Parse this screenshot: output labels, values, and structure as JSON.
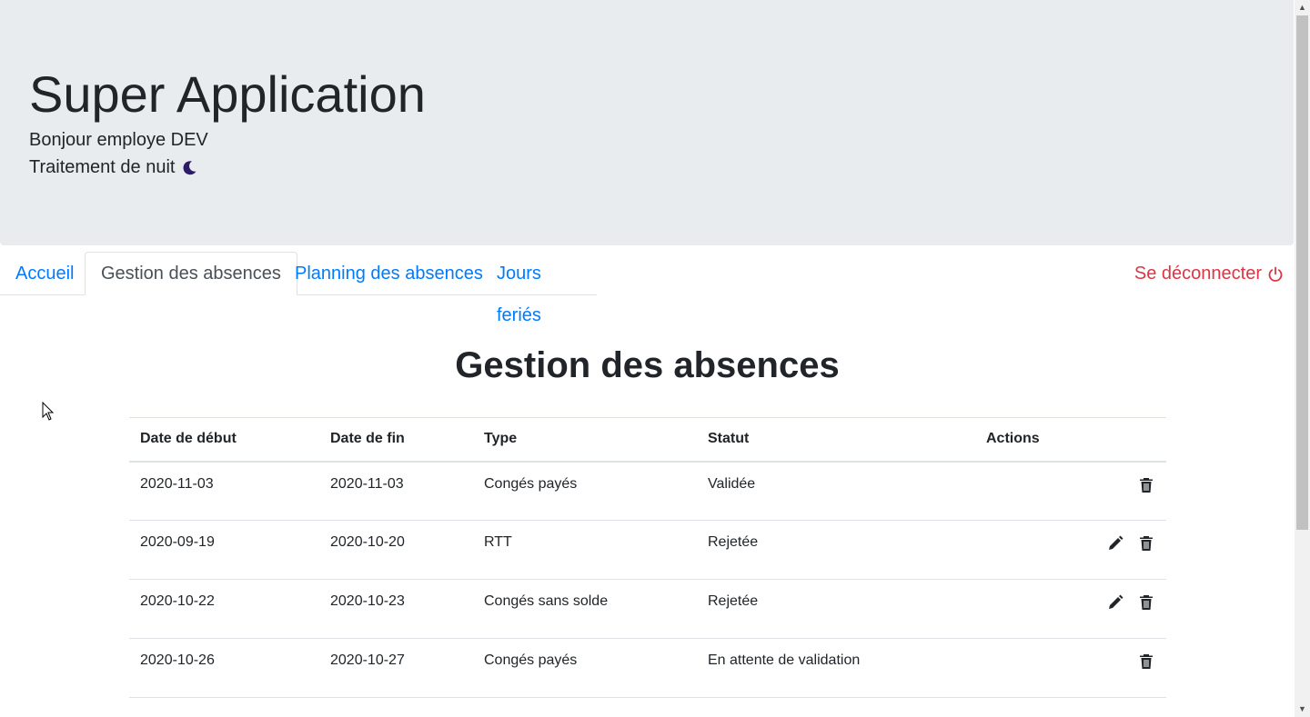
{
  "header": {
    "title": "Super Application",
    "greeting": "Bonjour employe DEV",
    "night_label": "Traitement de nuit"
  },
  "nav": {
    "tabs": [
      {
        "label": "Accueil"
      },
      {
        "label": "Gestion des absences"
      },
      {
        "label": "Planning des absences"
      },
      {
        "label": "Jours feriés"
      }
    ],
    "active_tab": "Gestion des absences",
    "logout_label": "Se déconnecter"
  },
  "main": {
    "title": "Gestion des absences",
    "table": {
      "headers": [
        "Date de début",
        "Date de fin",
        "Type",
        "Statut",
        "Actions"
      ],
      "rows": [
        {
          "start": "2020-11-03",
          "end": "2020-11-03",
          "type": "Congés payés",
          "status": "Validée",
          "actions": [
            "delete-icon"
          ]
        },
        {
          "start": "2020-09-19",
          "end": "2020-10-20",
          "type": "RTT",
          "status": "Rejetée",
          "actions": [
            "edit-icon",
            "delete-icon"
          ]
        },
        {
          "start": "2020-10-22",
          "end": "2020-10-23",
          "type": "Congés sans solde",
          "status": "Rejetée",
          "actions": [
            "edit-icon",
            "delete-icon"
          ]
        },
        {
          "start": "2020-10-26",
          "end": "2020-10-27",
          "type": "Congés payés",
          "status": "En attente de validation",
          "actions": [
            "delete-icon"
          ]
        }
      ]
    }
  },
  "colors": {
    "header_bg": "#e9ecef",
    "link": "#007bff",
    "danger": "#dc3545",
    "moon": "#2c1a6b"
  },
  "icons": {
    "night": "moon-icon",
    "logout": "power-icon",
    "edit": "pencil-icon",
    "delete": "trash-icon"
  }
}
